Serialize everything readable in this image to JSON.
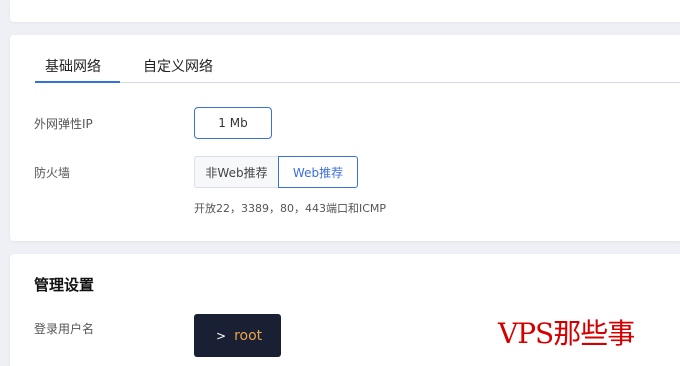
{
  "network": {
    "tabs": [
      {
        "label": "基础网络",
        "active": true
      },
      {
        "label": "自定义网络",
        "active": false
      }
    ],
    "bandwidth": {
      "label": "外网弹性IP",
      "value": "1 Mb"
    },
    "firewall": {
      "label": "防火墙",
      "options": [
        "非Web推荐",
        "Web推荐"
      ],
      "selected": "Web推荐",
      "note": "开放22，3389，80，443端口和ICMP"
    }
  },
  "management": {
    "title": "管理设置",
    "username_label": "登录用户名",
    "username_prompt": ">",
    "username_value": "root"
  },
  "watermark": "VPS那些事",
  "colors": {
    "accent": "#3d6ee0",
    "terminal_bg": "#1a2034",
    "terminal_text": "#e8a449",
    "watermark": "#d40000"
  }
}
